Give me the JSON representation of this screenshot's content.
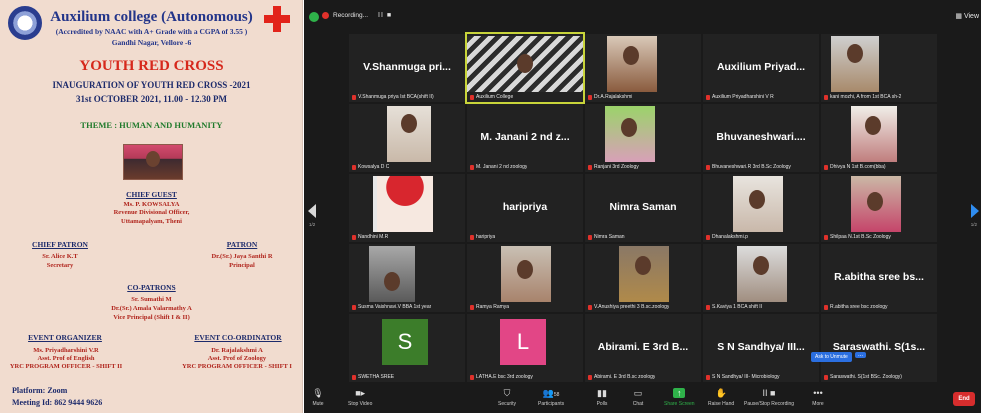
{
  "poster": {
    "college": "Auxilium college (Autonomous)",
    "accreditation": "(Accredited by NAAC with A+ Grade with a CGPA of 3.55 )",
    "address": "Gandhi Nagar, Vellore -6",
    "event_title": "YOUTH RED CROSS",
    "inauguration": "INAUGURATION OF YOUTH RED CROSS -2021",
    "datetime": "31st OCTOBER 2021, 11.00 - 12.30 PM",
    "theme": "THEME : HUMAN AND HUMANITY",
    "chief_guest": {
      "heading": "CHIEF GUEST",
      "line1": "Ms. P. KOWSALYA",
      "line2": "Revenue Divisional Officer,",
      "line3": "Uttamapalyam, Theni"
    },
    "chief_patron": {
      "heading": "CHIEF PATRON",
      "line1": "Sr. Alice K.T",
      "line2": "Secretary"
    },
    "patron": {
      "heading": "PATRON",
      "line1": "Dr.(Sr.) Jaya Santhi R",
      "line2": "Principal"
    },
    "co_patrons": {
      "heading": "CO-PATRONS",
      "line1": "Sr. Sumathi M",
      "line2": "Dr.(Sr.) Amala Valarmathy A",
      "line3": "Vice Principal (Shift I & II)"
    },
    "organizer": {
      "heading": "EVENT ORGANIZER",
      "line1": "Ms. Priyadharshini V.R",
      "line2": "Asst. Prof of English",
      "line3": "YRC PROGRAM OFFICER - SHIFT II"
    },
    "coordinator": {
      "heading": "EVENT CO-ORDINATOR",
      "line1": "Dr. Rajalakshmi A",
      "line2": "Asst. Prof of Zoology",
      "line3": "YRC PROGRAM OFFICER - SHIFT I"
    },
    "platform": "Platform: Zoom",
    "meeting_id": "Meeting Id: 862 9444 9626"
  },
  "zoom": {
    "recording_label": "Recording...",
    "recording_controls": "II ■",
    "view_label": "View",
    "page_left": "1/2",
    "page_right": "1/2",
    "ask_to_unmute": "Ask to Unmute",
    "more": "...",
    "tiles": [
      {
        "big": "V.Shanmuga pri...",
        "cap": "V.Shanmuga priya Ist BCA(shift II)"
      },
      {
        "big": "",
        "cap": "Auxilium College"
      },
      {
        "big": "",
        "cap": "Dr.A.Rajalakshmi"
      },
      {
        "big": "Auxilium Priyad...",
        "cap": "Auxilium Priyadharshini V R"
      },
      {
        "big": "",
        "cap": "kani mozhi, A from 1st BCA sh-2"
      },
      {
        "big": "",
        "cap": "Kowsalya D C"
      },
      {
        "big": "M. Janani 2 nd z...",
        "cap": "M. Janani 2 nd zoology"
      },
      {
        "big": "",
        "cap": "Ranjani 3rd Zoology"
      },
      {
        "big": "Bhuvaneshwari....",
        "cap": "Bhuvaneshwari.R 3rd B.Sc Zoology"
      },
      {
        "big": "",
        "cap": "Dhivya N 1st B.com(bba)"
      },
      {
        "big": "",
        "cap": "Nandhini M.R"
      },
      {
        "big": "haripriya",
        "cap": "haripriya"
      },
      {
        "big": "Nimra Saman",
        "cap": "Nimra Saman"
      },
      {
        "big": "",
        "cap": "Dhanalakshmi.p"
      },
      {
        "big": "",
        "cap": "Shilpaa N.1st B.Sc Zoology"
      },
      {
        "big": "",
        "cap": "Susma Vaishnavi.V BBA 1st year"
      },
      {
        "big": "",
        "cap": "Ramya Ramya"
      },
      {
        "big": "",
        "cap": "V.Anushiya preethi 3 B.sc.zoology"
      },
      {
        "big": "",
        "cap": "S.Kaviya 1 BCA shift II"
      },
      {
        "big": "R.abitha sree bs...",
        "cap": "R.abitha sree bsc zoology"
      },
      {
        "big": "",
        "cap": "SWETHA SREE",
        "avatar": "S"
      },
      {
        "big": "",
        "cap": "LATHA.E bsc 3rd zoology",
        "avatar": "L"
      },
      {
        "big": "Abirami. E 3rd B...",
        "cap": "Abirami. E 3rd B.sc zoology"
      },
      {
        "big": "S N Sandhya/ III...",
        "cap": "S N Sandhya/ III- Microbiology"
      },
      {
        "big": "Saraswathi. S(1s...",
        "cap": "Saraswathi. S(1st BSc. Zoology)"
      }
    ],
    "toolbar": {
      "mute": "Mute",
      "stop_video": "Stop Video",
      "security": "Security",
      "participants": "Participants",
      "participants_count": "58",
      "polls": "Polls",
      "chat": "Chat",
      "share_screen": "Share Screen",
      "raise_hand": "Raise Hand",
      "pause_recording": "Pause/Stop Recording",
      "more": "More",
      "end": "End"
    }
  },
  "colors": {
    "zoom_bg": "#1a1a1a",
    "tile_bg": "#222222",
    "active_speaker": "#c8d43a",
    "end_button": "#d72d2d",
    "avatar_s": "#3c7d2a",
    "avatar_l": "#e24686",
    "poster_bg": "#f1dccf"
  }
}
